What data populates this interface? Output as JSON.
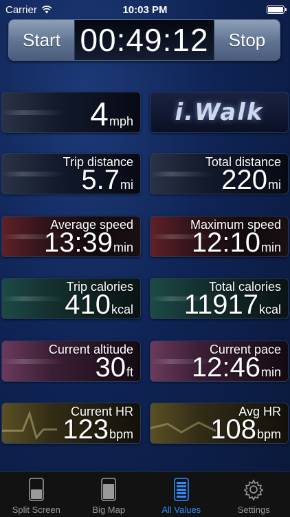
{
  "status_bar": {
    "carrier": "Carrier",
    "time": "10:03 PM"
  },
  "timer": {
    "start_label": "Start",
    "elapsed": "00:49:12",
    "stop_label": "Stop"
  },
  "speed": {
    "value": "4",
    "unit": "mph"
  },
  "logo": {
    "text": "i.Walk"
  },
  "metrics": [
    {
      "label": "Trip distance",
      "value": "5.7",
      "unit": "mi"
    },
    {
      "label": "Total distance",
      "value": "220",
      "unit": "mi"
    },
    {
      "label": "Average speed",
      "value": "13:39",
      "unit": "min"
    },
    {
      "label": "Maximum speed",
      "value": "12:10",
      "unit": "min"
    },
    {
      "label": "Trip calories",
      "value": "410",
      "unit": "kcal"
    },
    {
      "label": "Total calories",
      "value": "11917",
      "unit": "kcal"
    },
    {
      "label": "Current altitude",
      "value": "30",
      "unit": "ft"
    },
    {
      "label": "Current pace",
      "value": "12:46",
      "unit": "min"
    },
    {
      "label": "Current HR",
      "value": "123",
      "unit": "bpm"
    },
    {
      "label": "Avg HR",
      "value": "108",
      "unit": "bpm"
    }
  ],
  "tabs": [
    {
      "label": "Split Screen",
      "icon": "split-screen-icon"
    },
    {
      "label": "Big Map",
      "icon": "big-map-icon"
    },
    {
      "label": "All Values",
      "icon": "all-values-icon",
      "active": true
    },
    {
      "label": "Settings",
      "icon": "settings-gear-icon"
    }
  ],
  "colors": {
    "accent": "#2b8cff",
    "background": "#0f2455"
  }
}
